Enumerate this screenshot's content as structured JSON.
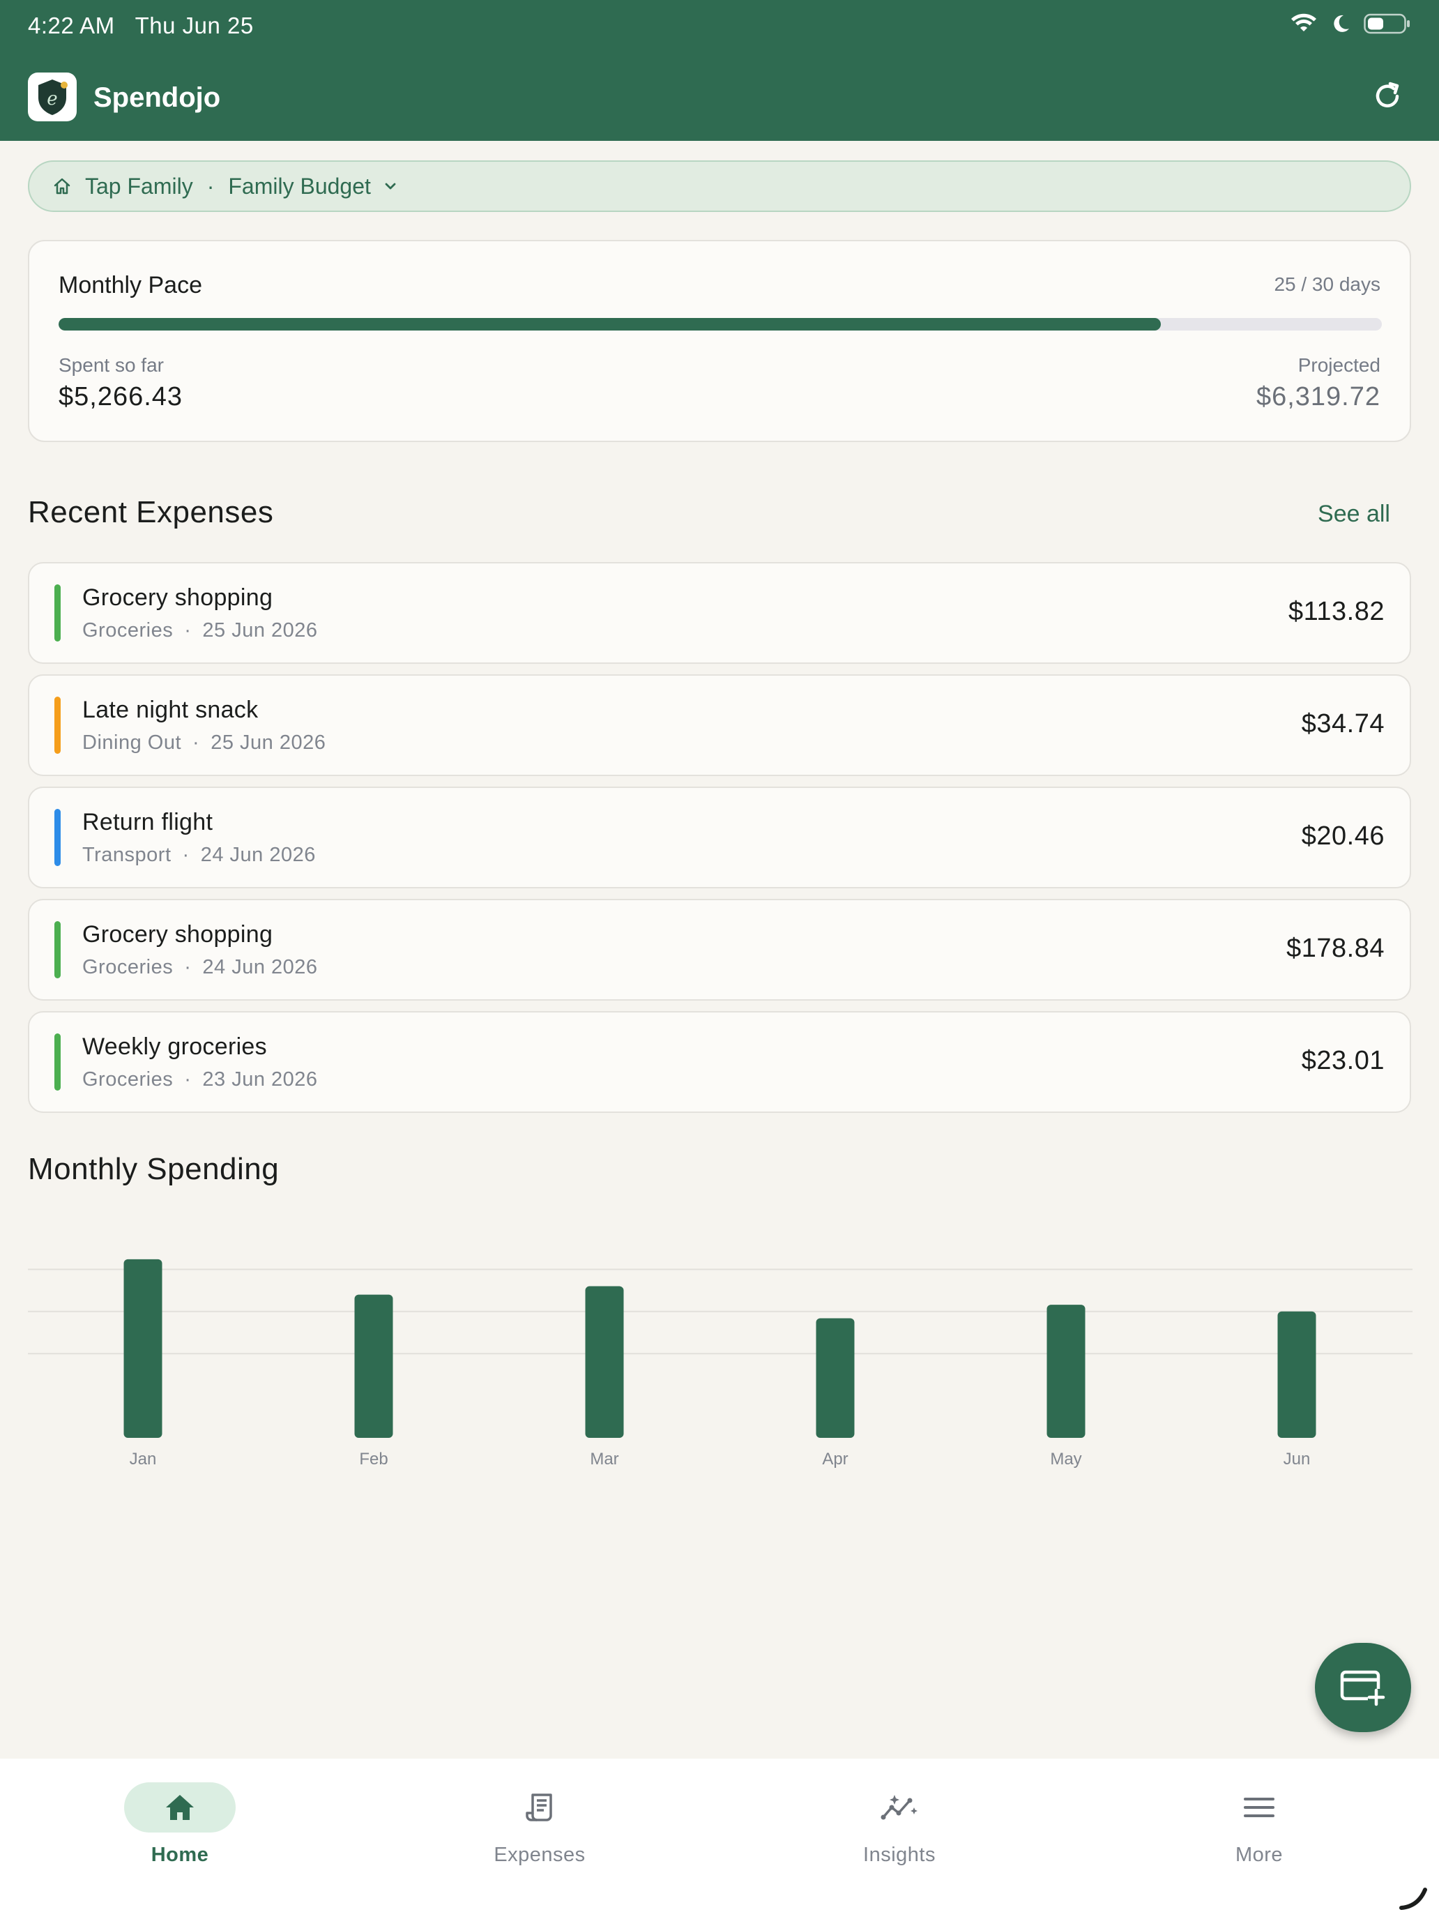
{
  "status_bar": {
    "time": "4:22 AM",
    "date": "Thu Jun 25"
  },
  "app": {
    "title": "Spendojo"
  },
  "budget_selector": {
    "family": "Tap Family",
    "separator": "·",
    "budget": "Family Budget"
  },
  "monthly_pace": {
    "title": "Monthly Pace",
    "days": "25 / 30 days",
    "progress": 0.833,
    "spent_label": "Spent so far",
    "spent_value": "$5,266.43",
    "projected_label": "Projected",
    "projected_value": "$6,319.72"
  },
  "recent_expenses": {
    "title": "Recent Expenses",
    "see_all": "See all",
    "items": [
      {
        "title": "Grocery shopping",
        "category": "Groceries",
        "date": "25 Jun 2026",
        "amount": "$113.82",
        "color": "#4caf50"
      },
      {
        "title": "Late night snack",
        "category": "Dining Out",
        "date": "25 Jun 2026",
        "amount": "$34.74",
        "color": "#f59e1b"
      },
      {
        "title": "Return flight",
        "category": "Transport",
        "date": "24 Jun 2026",
        "amount": "$20.46",
        "color": "#2d8ce8"
      },
      {
        "title": "Grocery shopping",
        "category": "Groceries",
        "date": "24 Jun 2026",
        "amount": "$178.84",
        "color": "#4caf50"
      },
      {
        "title": "Weekly groceries",
        "category": "Groceries",
        "date": "23 Jun 2026",
        "amount": "$23.01",
        "color": "#4caf50"
      }
    ]
  },
  "monthly_spending": {
    "title": "Monthly Spending"
  },
  "chart_data": {
    "type": "bar",
    "categories": [
      "Jan",
      "Feb",
      "Mar",
      "Apr",
      "May",
      "Jun"
    ],
    "values": [
      1.06,
      0.85,
      0.9,
      0.71,
      0.79,
      0.75
    ],
    "ylim": [
      0,
      1.25
    ],
    "grid": true,
    "bar_color": "#2f6b51"
  },
  "bottom_nav": [
    {
      "label": "Home",
      "icon": "home-icon",
      "active": true
    },
    {
      "label": "Expenses",
      "icon": "receipt-icon",
      "active": false
    },
    {
      "label": "Insights",
      "icon": "insights-icon",
      "active": false
    },
    {
      "label": "More",
      "icon": "menu-icon",
      "active": false
    }
  ],
  "fab": {
    "icon": "add-card-icon"
  },
  "colors": {
    "primary": "#2f6b51",
    "background": "#f6f4ef"
  }
}
